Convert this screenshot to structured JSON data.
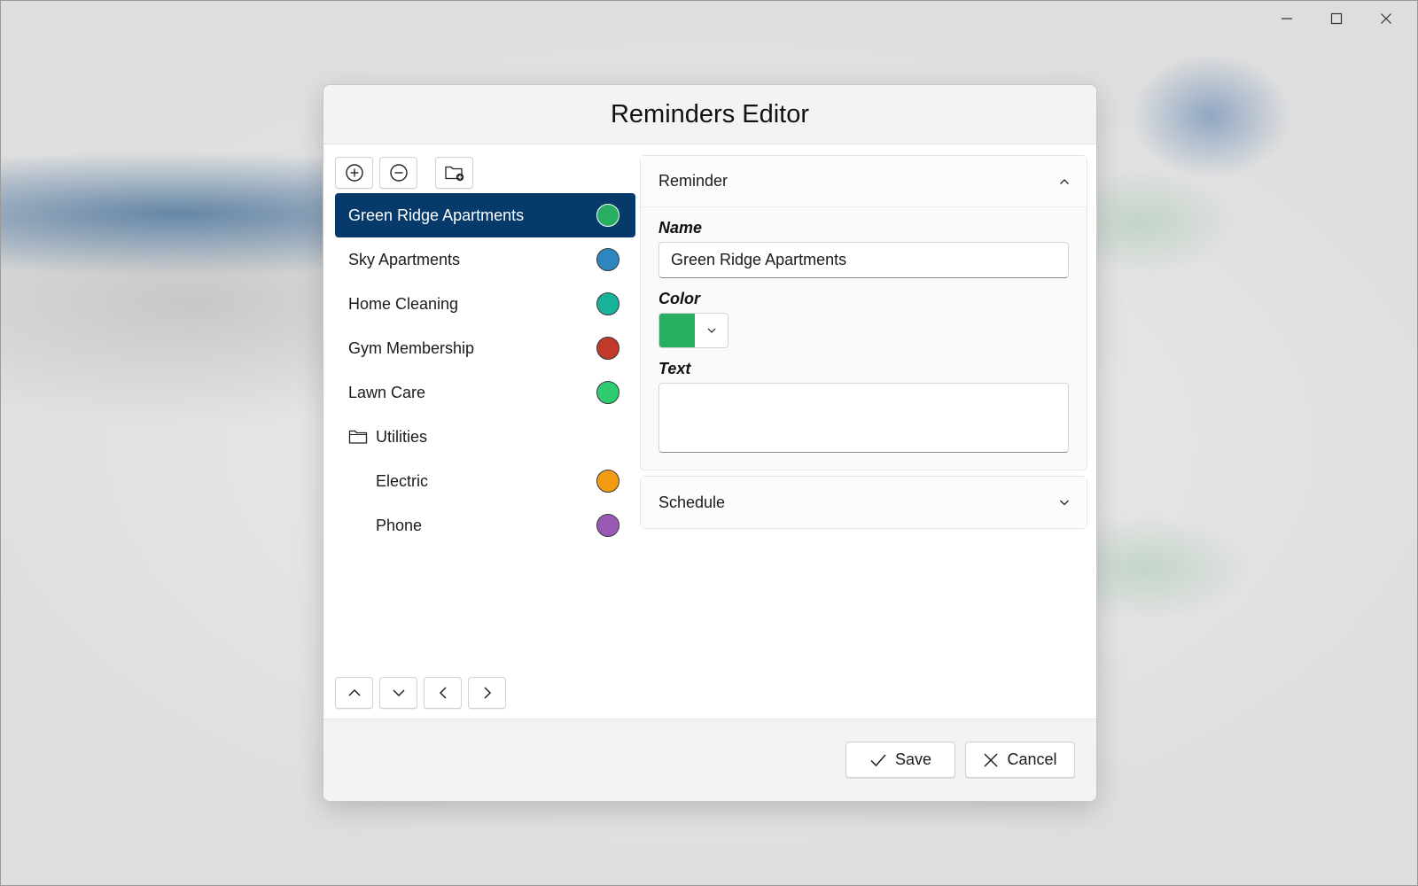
{
  "window": {
    "controls": [
      "minimize-icon",
      "maximize-icon",
      "close-icon"
    ]
  },
  "dialog": {
    "title": "Reminders Editor"
  },
  "toolbar": {
    "icons": [
      "add-circle-icon",
      "remove-circle-icon",
      "new-folder-icon"
    ]
  },
  "list": {
    "items": [
      {
        "label": "Green Ridge Apartments",
        "color": "#27ae60",
        "selected": true
      },
      {
        "label": "Sky Apartments",
        "color": "#2e86c1"
      },
      {
        "label": "Home Cleaning",
        "color": "#17b39a"
      },
      {
        "label": "Gym Membership",
        "color": "#c0392b"
      },
      {
        "label": "Lawn Care",
        "color": "#2ecc71"
      },
      {
        "label": "Utilities",
        "type": "folder",
        "icon": "folder-icon"
      },
      {
        "label": "Electric",
        "color": "#f39c12",
        "child": true
      },
      {
        "label": "Phone",
        "color": "#9b59b6",
        "child": true
      }
    ]
  },
  "nav": {
    "icons": [
      "chevron-up-icon",
      "chevron-down-icon",
      "chevron-left-icon",
      "chevron-right-icon"
    ]
  },
  "reminder_section": {
    "title": "Reminder",
    "name_label": "Name",
    "name_value": "Green Ridge Apartments",
    "color_label": "Color",
    "color_value": "#27ae60",
    "text_label": "Text",
    "text_value": ""
  },
  "schedule_section": {
    "title": "Schedule"
  },
  "footer": {
    "save_label": "Save",
    "cancel_label": "Cancel"
  }
}
